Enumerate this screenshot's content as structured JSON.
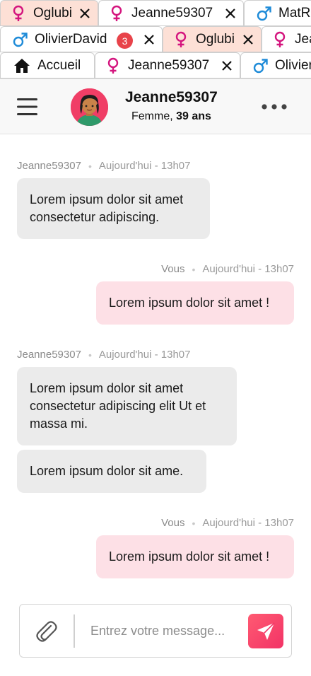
{
  "tabs": {
    "row1": [
      {
        "label": "Oglubi",
        "gender": "female",
        "closable": true
      },
      {
        "label": "Jeanne59307",
        "gender": "female",
        "closable": true
      },
      {
        "label": "MatR",
        "gender": "male",
        "closable": false
      }
    ],
    "row2": [
      {
        "label": "OlivierDavid",
        "gender": "male",
        "badge": "3",
        "closable": true
      },
      {
        "label": "Oglubi",
        "gender": "female",
        "closable": true
      },
      {
        "label": "Jea",
        "gender": "female",
        "closable": false
      }
    ],
    "row3": [
      {
        "label": "Accueil",
        "icon": "home-icon",
        "closable": false
      },
      {
        "label": "Jeanne59307",
        "gender": "female",
        "closable": true
      },
      {
        "label": "Olivier",
        "gender": "male",
        "closable": false
      }
    ]
  },
  "header": {
    "username": "Jeanne59307",
    "gender_label": "Femme,",
    "age_label": "39 ans"
  },
  "messages": [
    {
      "from": "Jeanne59307",
      "time": "Aujourd'hui - 13h07",
      "bubbles": [
        "Lorem ipsum dolor sit amet consectetur adipiscing."
      ]
    },
    {
      "from": "Vous",
      "time": "Aujourd'hui - 13h07",
      "bubbles": [
        "Lorem ipsum dolor sit amet !"
      ]
    },
    {
      "from": "Jeanne59307",
      "time": "Aujourd'hui - 13h07",
      "bubbles": [
        "Lorem ipsum dolor sit amet consectetur adipiscing elit Ut et massa mi.",
        "Lorem ipsum dolor sit ame."
      ]
    },
    {
      "from": "Vous",
      "time": "Aujourd'hui - 13h07",
      "bubbles": [
        "Lorem ipsum dolor sit amet !"
      ]
    }
  ],
  "composer": {
    "placeholder": "Entrez votre message...",
    "value": ""
  },
  "colors": {
    "accent": "#f23366",
    "female_icon": "#d4157e",
    "male_icon": "#1e8bd8",
    "tab_active": "#fde0d6",
    "bubble_in": "#ebebeb",
    "bubble_out": "#fde0e6",
    "badge": "#e8434a"
  }
}
